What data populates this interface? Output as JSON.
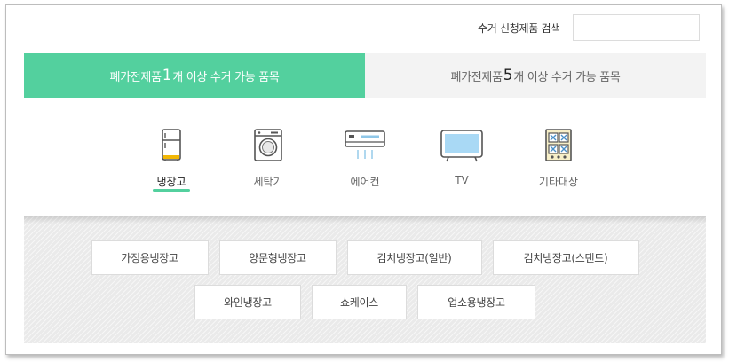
{
  "search": {
    "label": "수거 신청제품 검색",
    "value": "",
    "placeholder": ""
  },
  "tabs": [
    {
      "prefix": "폐가전제품 ",
      "count": "1",
      "suffix": "개 이상 수거 가능 품목",
      "active": true
    },
    {
      "prefix": "폐가전제품 ",
      "count": "5",
      "suffix": "개 이상 수거 가능 품목",
      "active": false
    }
  ],
  "categories": [
    {
      "label": "냉장고",
      "icon": "refrigerator-icon",
      "active": true
    },
    {
      "label": "세탁기",
      "icon": "washing-machine-icon",
      "active": false
    },
    {
      "label": "에어컨",
      "icon": "air-conditioner-icon",
      "active": false
    },
    {
      "label": "TV",
      "icon": "tv-icon",
      "active": false
    },
    {
      "label": "기타대상",
      "icon": "other-items-icon",
      "active": false
    }
  ],
  "subcategories": [
    "가정용냉장고",
    "양문형냉장고",
    "김치냉장고(일반)",
    "김치냉장고(스탠드)",
    "와인냉장고",
    "쇼케이스",
    "업소용냉장고"
  ],
  "colors": {
    "accent": "#53d09e",
    "inactive_tab": "#f3f3f3",
    "sub_area": "#eaeaea"
  }
}
